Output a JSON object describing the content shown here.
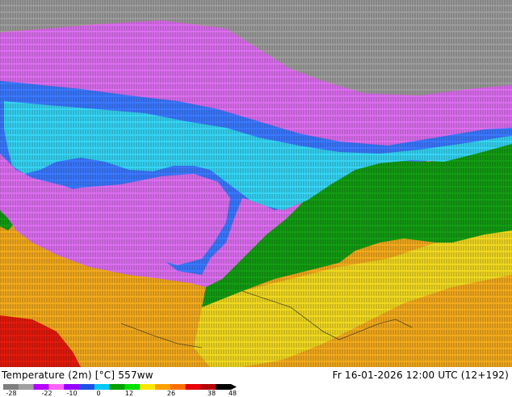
{
  "product": {
    "title": "Temperature (2m) [°C] 557ww",
    "valid_time": "Fr 16-01-2026 12:00 UTC (12+192)"
  },
  "colorbar": {
    "ticks": [
      "-28",
      "-22",
      "-10",
      "0",
      "12",
      "26",
      "38",
      "48"
    ],
    "colors": [
      "#7f7f7f",
      "#a0a0a0",
      "#b400ff",
      "#ff64ff",
      "#9600ff",
      "#1e50e6",
      "#00c8ff",
      "#00a000",
      "#00e000",
      "#ffe600",
      "#ffa000",
      "#ff6e00",
      "#e60000",
      "#b40000",
      "#000000"
    ]
  },
  "map": {
    "zone_colors": {
      "cold_gray": "#9c9c9c",
      "magenta": "#dc6ef0",
      "blue": "#3a78ff",
      "cyan": "#35d4f4",
      "green": "#139c13",
      "yellow": "#f0d820",
      "orange": "#f2aa1c",
      "red": "#e21a0c"
    }
  }
}
